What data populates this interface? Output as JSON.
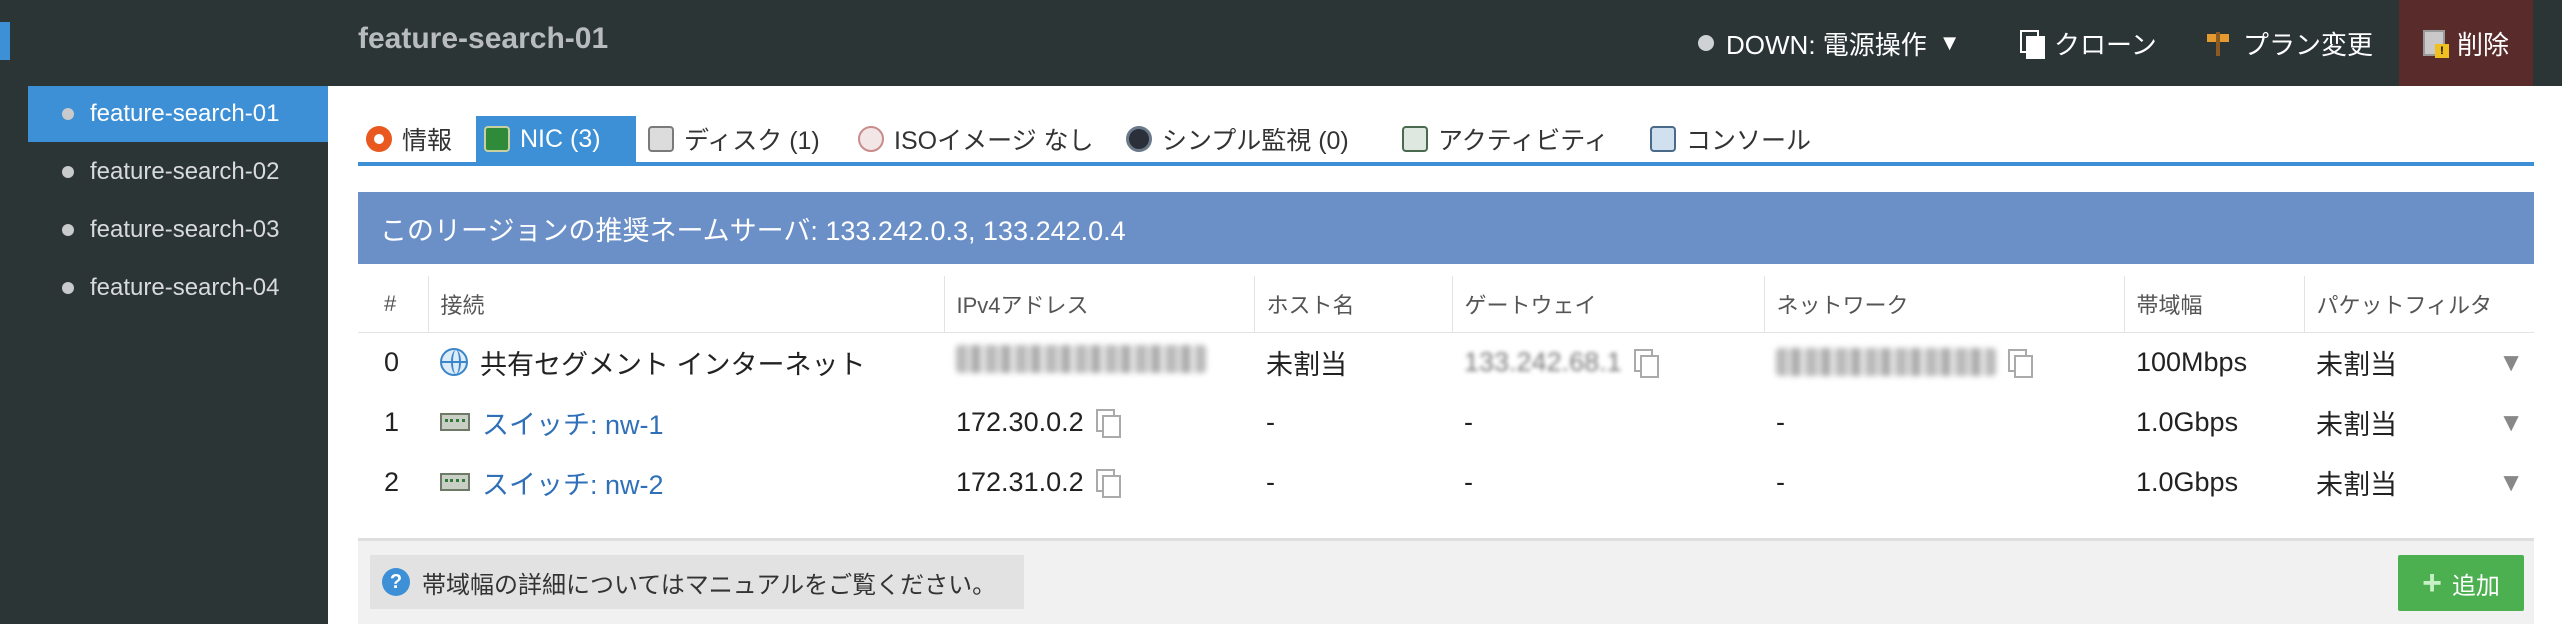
{
  "header": {
    "title": "feature-search-01",
    "power_label": "DOWN: 電源操作",
    "power_caret": "▼",
    "clone_label": "クローン",
    "plan_label": "プラン変更",
    "delete_label": "削除"
  },
  "sidebar": {
    "items": [
      {
        "label": "feature-search-01",
        "active": true
      },
      {
        "label": "feature-search-02",
        "active": false
      },
      {
        "label": "feature-search-03",
        "active": false
      },
      {
        "label": "feature-search-04",
        "active": false
      }
    ]
  },
  "tabs": [
    {
      "label": "情報"
    },
    {
      "label": "NIC (3)"
    },
    {
      "label": "ディスク (1)"
    },
    {
      "label": "ISOイメージ なし"
    },
    {
      "label": "シンプル監視 (0)"
    },
    {
      "label": "アクティビティ"
    },
    {
      "label": "コンソール"
    }
  ],
  "banner": {
    "text": "このリージョンの推奨ネームサーバ: 133.242.0.3, 133.242.0.4"
  },
  "nic_table": {
    "headers": [
      "#",
      "接続",
      "IPv4アドレス",
      "ホスト名",
      "ゲートウェイ",
      "ネットワーク",
      "帯域幅",
      "パケットフィルタ"
    ],
    "rows": [
      {
        "index": "0",
        "connection": "共有セグメント インターネット",
        "ipv4": "",
        "hostname": "未割当",
        "gateway": "133.242.68.1",
        "network": "",
        "bandwidth": "100Mbps",
        "filter": "未割当"
      },
      {
        "index": "1",
        "connection": "スイッチ: nw-1",
        "ipv4": "172.30.0.2",
        "hostname": "-",
        "gateway": "-",
        "network": "-",
        "bandwidth": "1.0Gbps",
        "filter": "未割当"
      },
      {
        "index": "2",
        "connection": "スイッチ: nw-2",
        "ipv4": "172.31.0.2",
        "hostname": "-",
        "gateway": "-",
        "network": "-",
        "bandwidth": "1.0Gbps",
        "filter": "未割当"
      }
    ]
  },
  "footer": {
    "help_text": "帯域幅の詳細についてはマニュアルをご覧ください。",
    "add_label": "追加"
  },
  "colors": {
    "accent": "#3d8fd6",
    "banner": "#6b8fc7",
    "header_bg": "#2b3536",
    "delete_bg": "#5a2b2b",
    "add_button": "#4caf50"
  }
}
